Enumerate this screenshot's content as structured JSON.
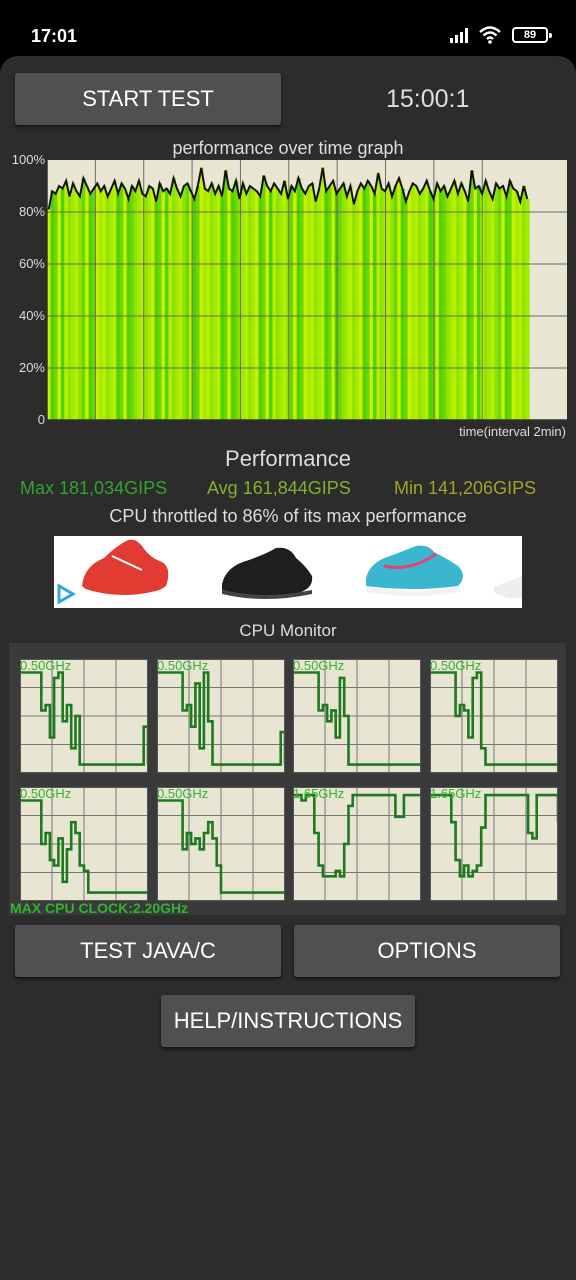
{
  "status_bar": {
    "time": "17:01",
    "battery": "89",
    "icons": [
      "signal-icon",
      "wifi-icon",
      "battery-icon"
    ]
  },
  "controls": {
    "start_test_label": "START TEST",
    "timer": "15:00:1"
  },
  "graph": {
    "title": "performance over time graph",
    "y_ticks": [
      "100%",
      "80%",
      "60%",
      "40%",
      "20%",
      "0"
    ],
    "x_label": "time(interval 2min)",
    "series_percent": [
      81,
      88,
      87,
      90,
      89,
      92,
      86,
      91,
      88,
      86,
      93,
      90,
      87,
      89,
      91,
      88,
      90,
      86,
      89,
      92,
      87,
      91,
      89,
      85,
      90,
      88,
      92,
      87,
      86,
      90,
      89,
      84,
      91,
      88,
      89,
      87,
      93,
      89,
      86,
      90,
      91,
      88,
      85,
      90,
      97,
      89,
      88,
      91,
      87,
      90,
      86,
      96,
      89,
      88,
      92,
      85,
      91,
      87,
      90,
      89,
      88,
      86,
      94,
      90,
      88,
      91,
      89,
      87,
      92,
      85,
      90,
      88,
      93,
      89,
      87,
      90,
      91,
      84,
      89,
      97,
      88,
      90,
      92,
      87,
      89,
      91,
      86,
      90,
      83,
      88,
      91,
      89,
      92,
      90,
      87,
      95,
      89,
      88,
      91,
      86,
      90,
      93,
      89,
      84,
      88,
      91,
      90,
      87,
      89,
      92,
      88,
      85,
      91,
      88,
      90,
      86,
      89,
      92,
      87,
      91,
      88,
      84,
      96,
      89,
      90,
      87,
      92,
      88,
      85,
      91,
      89,
      90,
      86,
      92,
      89,
      88,
      84,
      90,
      85
    ],
    "fill_colors": [
      "#c8f000",
      "#8ee400",
      "#4ed200",
      "#a6ea00",
      "#6ad800",
      "#b4f000"
    ],
    "line_color": "#111111",
    "background": "#e8e6d2"
  },
  "performance": {
    "heading": "Performance",
    "max": "Max 181,034GIPS",
    "avg": "Avg 161,844GIPS",
    "min": "Min 141,206GIPS",
    "throttle": "CPU throttled to 86% of its max performance"
  },
  "ad": {
    "icons": [
      "ad-choices-icon",
      "red-sneaker-icon",
      "black-sneaker-icon",
      "blue-sneaker-icon"
    ]
  },
  "cpu_monitor": {
    "title": "CPU Monitor",
    "cores": [
      {
        "freq": "0.50GHz",
        "trace": [
          0.9,
          0.9,
          0.9,
          0.9,
          0.9,
          0.55,
          0.6,
          0.3,
          0.85,
          0.9,
          0.45,
          0.6,
          0.2,
          0.5,
          0.05,
          0.05,
          0.05,
          0.05,
          0.05,
          0.05,
          0.05,
          0.05,
          0.05,
          0.05,
          0.05,
          0.05,
          0.05,
          0.05,
          0.05,
          0.4,
          0.05
        ]
      },
      {
        "freq": "0.50GHz",
        "trace": [
          0.9,
          0.9,
          0.9,
          0.9,
          0.9,
          0.9,
          0.55,
          0.6,
          0.4,
          0.8,
          0.2,
          0.9,
          0.45,
          0.05,
          0.05,
          0.05,
          0.05,
          0.05,
          0.05,
          0.05,
          0.05,
          0.05,
          0.05,
          0.05,
          0.05,
          0.05,
          0.05,
          0.05,
          0.05,
          0.35,
          0.05
        ]
      },
      {
        "freq": "0.50GHz",
        "trace": [
          0.9,
          0.9,
          0.9,
          0.9,
          0.9,
          0.9,
          0.55,
          0.6,
          0.45,
          0.55,
          0.3,
          0.85,
          0.5,
          0.05,
          0.05,
          0.05,
          0.05,
          0.05,
          0.05,
          0.05,
          0.05,
          0.05,
          0.05,
          0.05,
          0.05,
          0.05,
          0.05,
          0.05,
          0.05,
          0.05,
          0.05
        ]
      },
      {
        "freq": "0.50GHz",
        "trace": [
          0.9,
          0.9,
          0.9,
          0.9,
          0.9,
          0.9,
          0.5,
          0.6,
          0.55,
          0.3,
          0.85,
          0.9,
          0.2,
          0.05,
          0.05,
          0.05,
          0.05,
          0.05,
          0.05,
          0.05,
          0.05,
          0.05,
          0.05,
          0.05,
          0.05,
          0.05,
          0.05,
          0.05,
          0.05,
          0.05,
          0.05
        ]
      },
      {
        "freq": "0.50GHz",
        "trace": [
          0.9,
          0.9,
          0.9,
          0.9,
          0.9,
          0.5,
          0.6,
          0.35,
          0.3,
          0.55,
          0.15,
          0.45,
          0.7,
          0.6,
          0.3,
          0.25,
          0.05,
          0.05,
          0.05,
          0.05,
          0.05,
          0.05,
          0.05,
          0.05,
          0.05,
          0.05,
          0.05,
          0.05,
          0.05,
          0.05,
          0.05
        ]
      },
      {
        "freq": "0.50GHz",
        "trace": [
          0.9,
          0.9,
          0.9,
          0.9,
          0.9,
          0.9,
          0.45,
          0.6,
          0.5,
          0.55,
          0.45,
          0.6,
          0.7,
          0.55,
          0.3,
          0.05,
          0.05,
          0.05,
          0.05,
          0.05,
          0.05,
          0.05,
          0.05,
          0.05,
          0.05,
          0.05,
          0.05,
          0.05,
          0.05,
          0.05,
          0.05
        ]
      },
      {
        "freq": "1.65GHz",
        "trace": [
          0.95,
          0.95,
          0.9,
          0.95,
          0.95,
          0.6,
          0.3,
          0.2,
          0.2,
          0.2,
          0.25,
          0.2,
          0.5,
          0.85,
          0.95,
          0.95,
          0.95,
          0.95,
          0.95,
          0.95,
          0.95,
          0.95,
          0.95,
          0.95,
          0.75,
          0.75,
          0.95,
          0.95,
          0.95,
          0.95,
          0.95
        ]
      },
      {
        "freq": "1.65GHz",
        "trace": [
          0.95,
          0.95,
          0.95,
          0.95,
          0.95,
          0.7,
          0.35,
          0.2,
          0.3,
          0.2,
          0.25,
          0.3,
          0.65,
          0.95,
          0.95,
          0.95,
          0.95,
          0.95,
          0.95,
          0.95,
          0.95,
          0.95,
          0.95,
          0.6,
          0.55,
          0.95,
          0.95,
          0.95,
          0.95,
          0.95,
          0.7
        ]
      }
    ],
    "max_clock": "MAX CPU CLOCK:2.20GHz"
  },
  "buttons": {
    "test_java": "TEST JAVA/C",
    "options": "OPTIONS",
    "help": "HELP/INSTRUCTIONS"
  }
}
